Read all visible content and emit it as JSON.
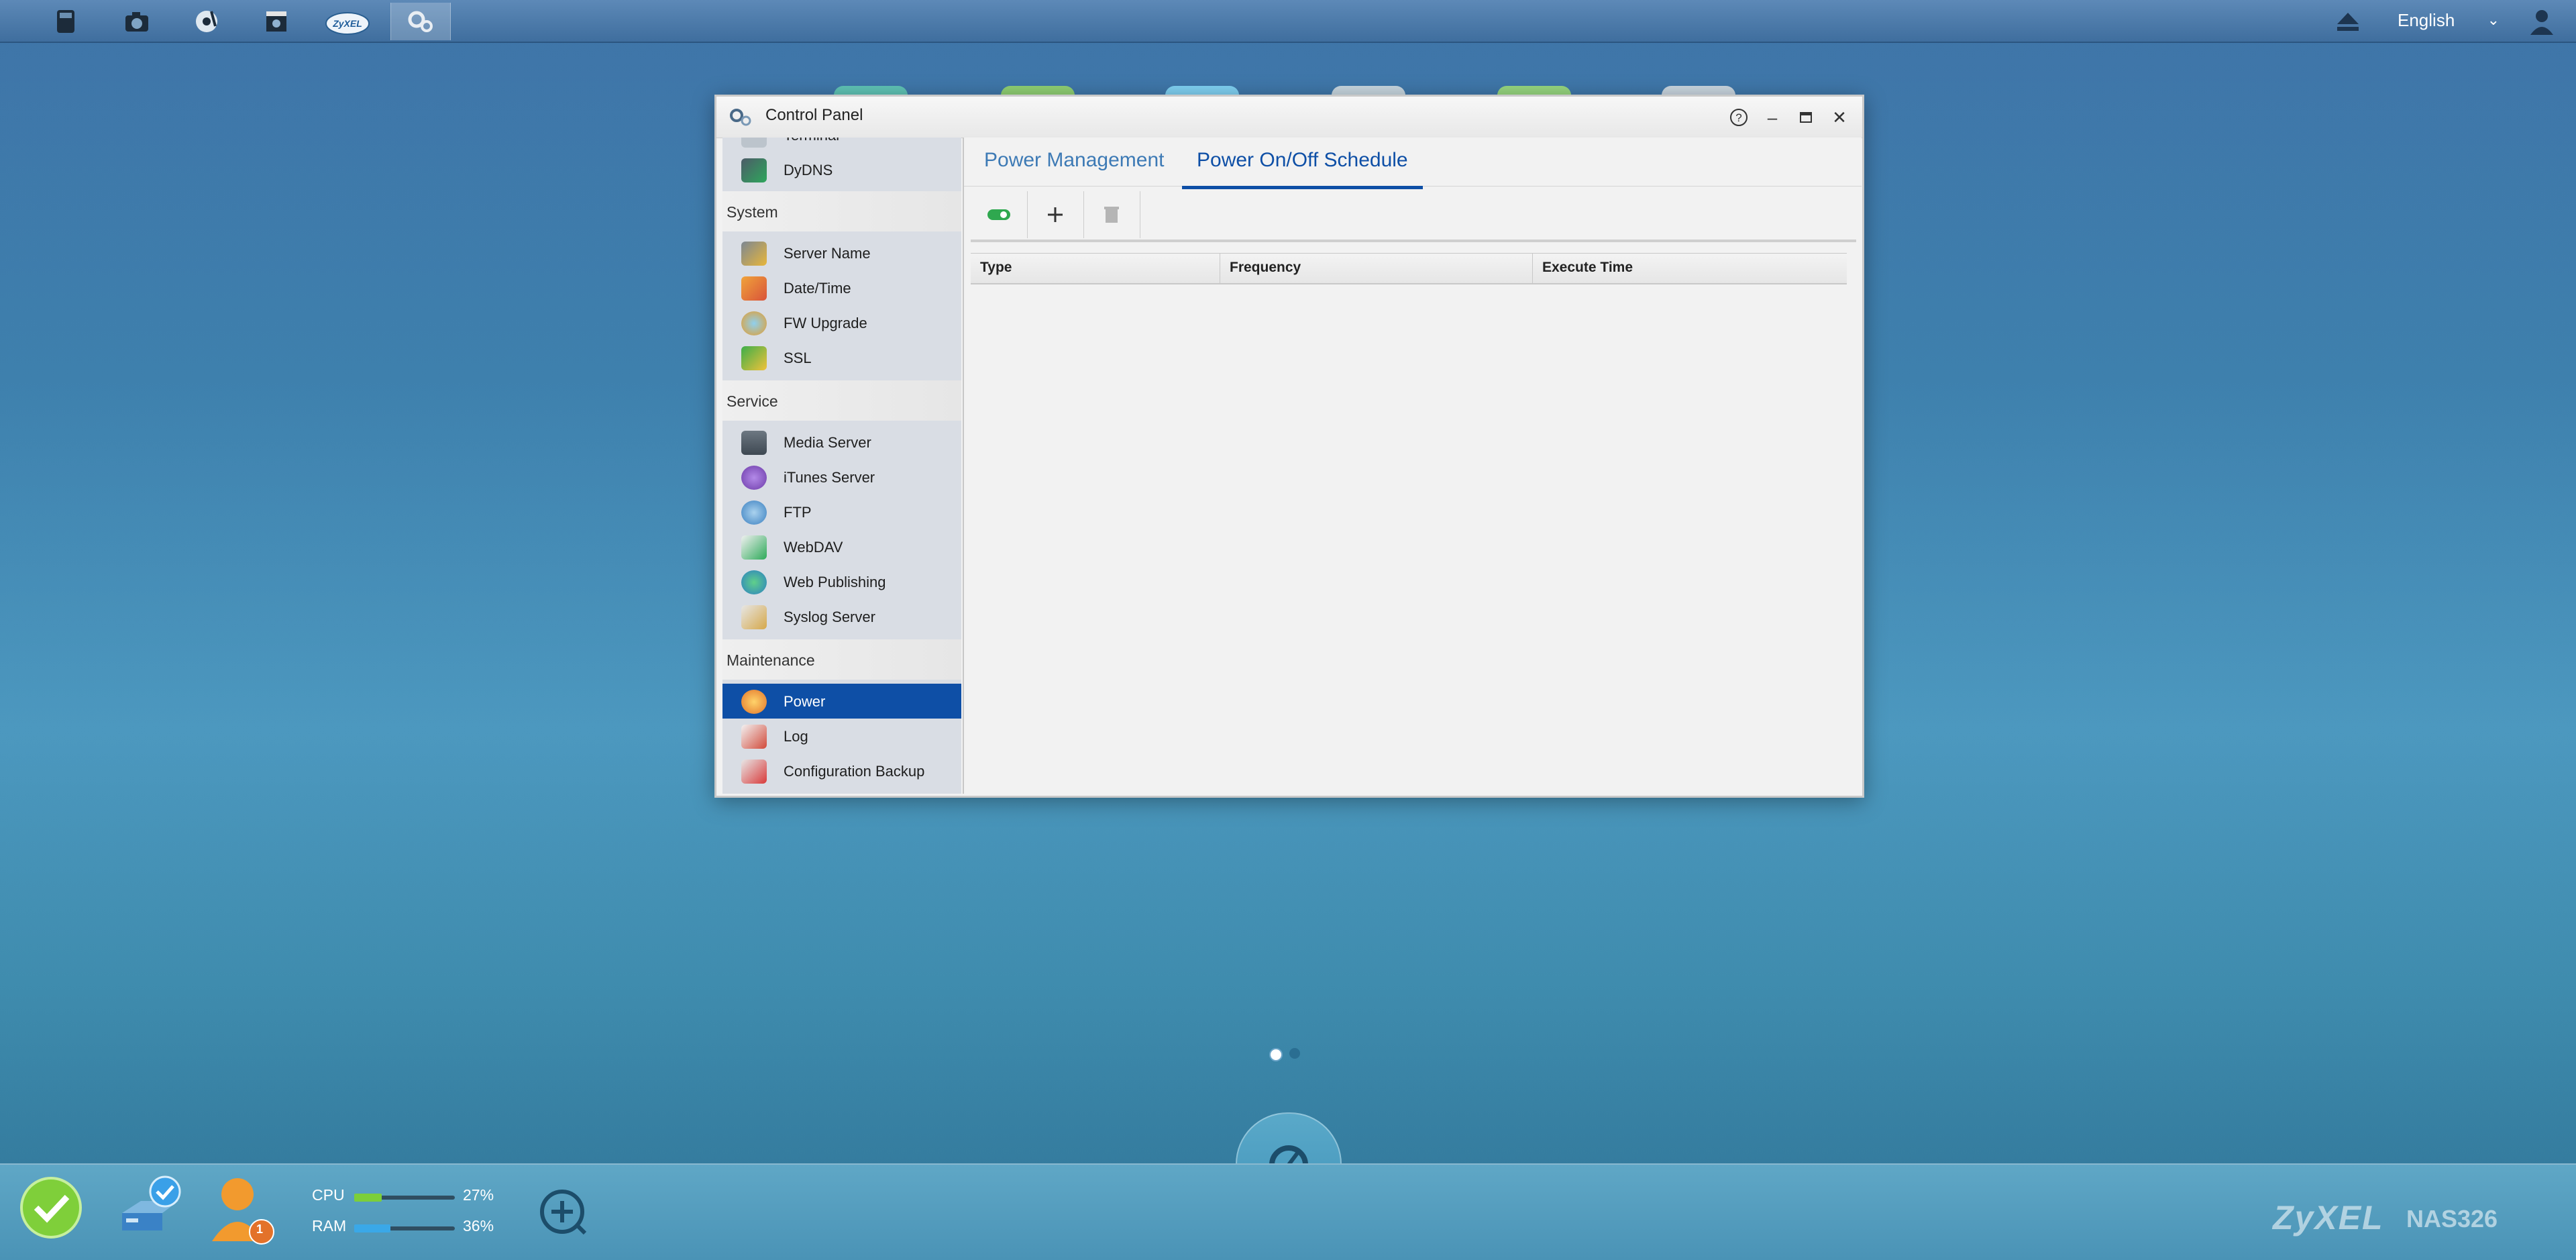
{
  "topbar": {
    "apps": [
      {
        "icon": "file-browser-icon"
      },
      {
        "icon": "photo-camera-icon"
      },
      {
        "icon": "music-player-icon"
      },
      {
        "icon": "video-player-icon"
      },
      {
        "icon": "zyxel-cloud-icon",
        "text": "ZyXEL"
      },
      {
        "icon": "control-panel-gears-icon",
        "active": true
      }
    ],
    "language": "English"
  },
  "window": {
    "title": "Control Panel",
    "sidebar": {
      "items_top": [
        {
          "label": "Terminal"
        },
        {
          "label": "DyDNS"
        }
      ],
      "groups": [
        {
          "label": "System",
          "items": [
            {
              "label": "Server Name"
            },
            {
              "label": "Date/Time"
            },
            {
              "label": "FW Upgrade"
            },
            {
              "label": "SSL"
            }
          ]
        },
        {
          "label": "Service",
          "items": [
            {
              "label": "Media Server"
            },
            {
              "label": "iTunes Server"
            },
            {
              "label": "FTP"
            },
            {
              "label": "WebDAV"
            },
            {
              "label": "Web Publishing"
            },
            {
              "label": "Syslog Server"
            }
          ]
        },
        {
          "label": "Maintenance",
          "items": [
            {
              "label": "Power",
              "selected": true
            },
            {
              "label": "Log"
            },
            {
              "label": "Configuration Backup"
            }
          ]
        }
      ]
    },
    "tabs": [
      {
        "label": "Power Management"
      },
      {
        "label": "Power On/Off Schedule",
        "active": true
      }
    ],
    "table": {
      "columns": [
        "Type",
        "Frequency",
        "Execute Time"
      ],
      "rows": []
    }
  },
  "taskbar": {
    "cpu": {
      "label": "CPU",
      "percent": "27%",
      "value": 0.27
    },
    "ram": {
      "label": "RAM",
      "percent": "36%",
      "value": 0.36
    },
    "badge_count": "1",
    "brand": "ZyXEL",
    "model": "NAS326"
  },
  "colors": {
    "accent": "#0e4fa6",
    "cpu_fill": "#7ccf3a",
    "ram_fill": "#3aa8e8",
    "toggle_on": "#2fa84f"
  }
}
